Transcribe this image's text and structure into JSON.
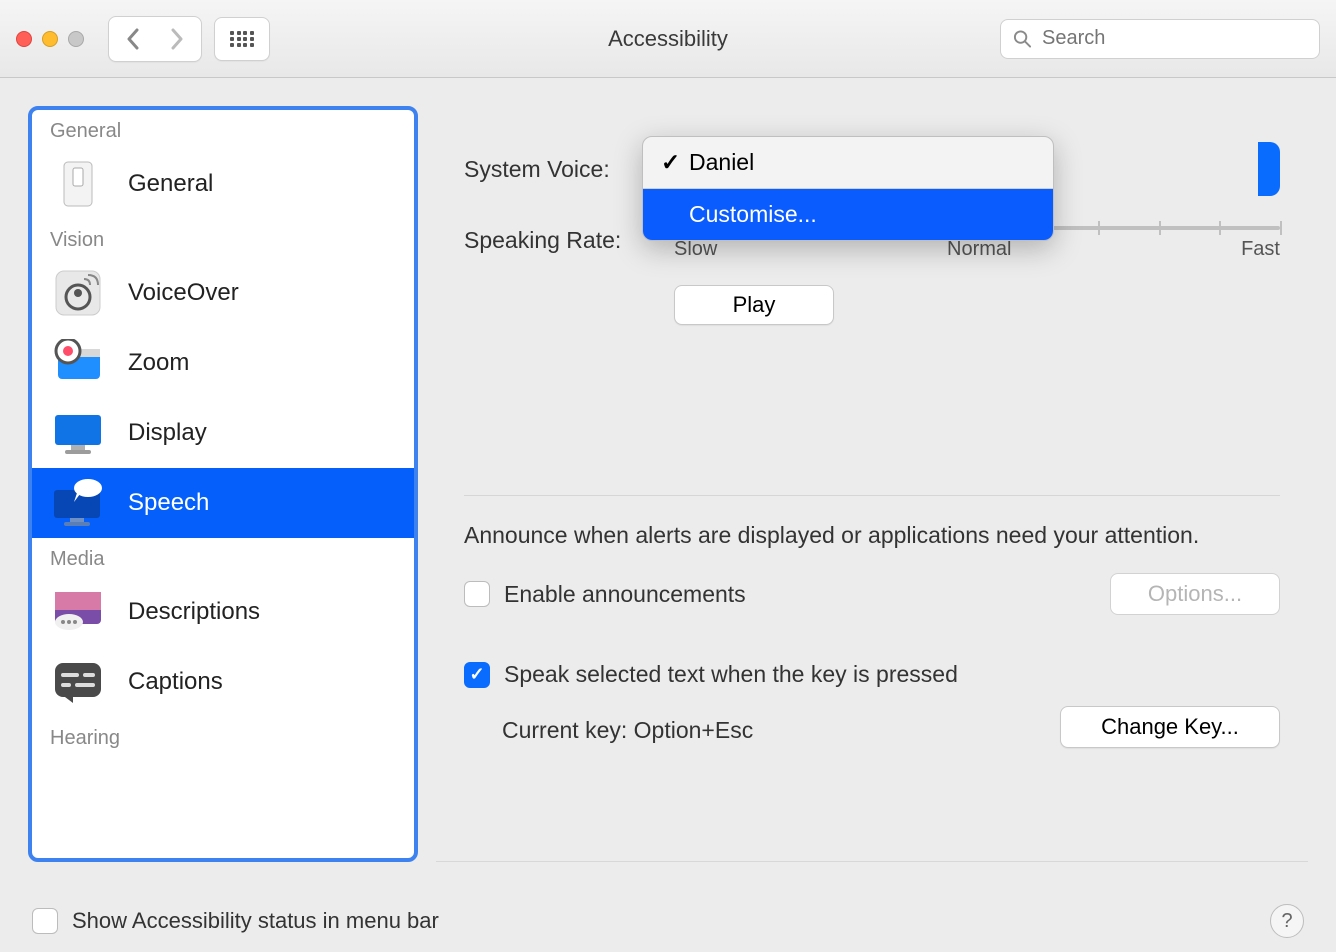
{
  "window": {
    "title": "Accessibility"
  },
  "search": {
    "placeholder": "Search"
  },
  "sidebar": {
    "sections": [
      {
        "label": "General",
        "items": [
          {
            "label": "General"
          }
        ]
      },
      {
        "label": "Vision",
        "items": [
          {
            "label": "VoiceOver"
          },
          {
            "label": "Zoom"
          },
          {
            "label": "Display"
          },
          {
            "label": "Speech",
            "selected": true
          }
        ]
      },
      {
        "label": "Media",
        "items": [
          {
            "label": "Descriptions"
          },
          {
            "label": "Captions"
          }
        ]
      },
      {
        "label": "Hearing",
        "items": []
      }
    ]
  },
  "main": {
    "system_voice_label": "System Voice:",
    "voice_options": [
      {
        "label": "Daniel",
        "checked": true
      },
      {
        "label": "Customise...",
        "highlighted": true
      }
    ],
    "speaking_rate_label": "Speaking Rate:",
    "rate_ticks": {
      "slow": "Slow",
      "normal": "Normal",
      "fast": "Fast"
    },
    "play_label": "Play",
    "announce_text": "Announce when alerts are displayed or applications need your attention.",
    "enable_announcements_label": "Enable announcements",
    "options_label": "Options...",
    "speak_selected_label": "Speak selected text when the key is pressed",
    "current_key_label": "Current key: Option+Esc",
    "change_key_label": "Change Key..."
  },
  "footer": {
    "show_status_label": "Show Accessibility status in menu bar",
    "help_icon": "?"
  }
}
